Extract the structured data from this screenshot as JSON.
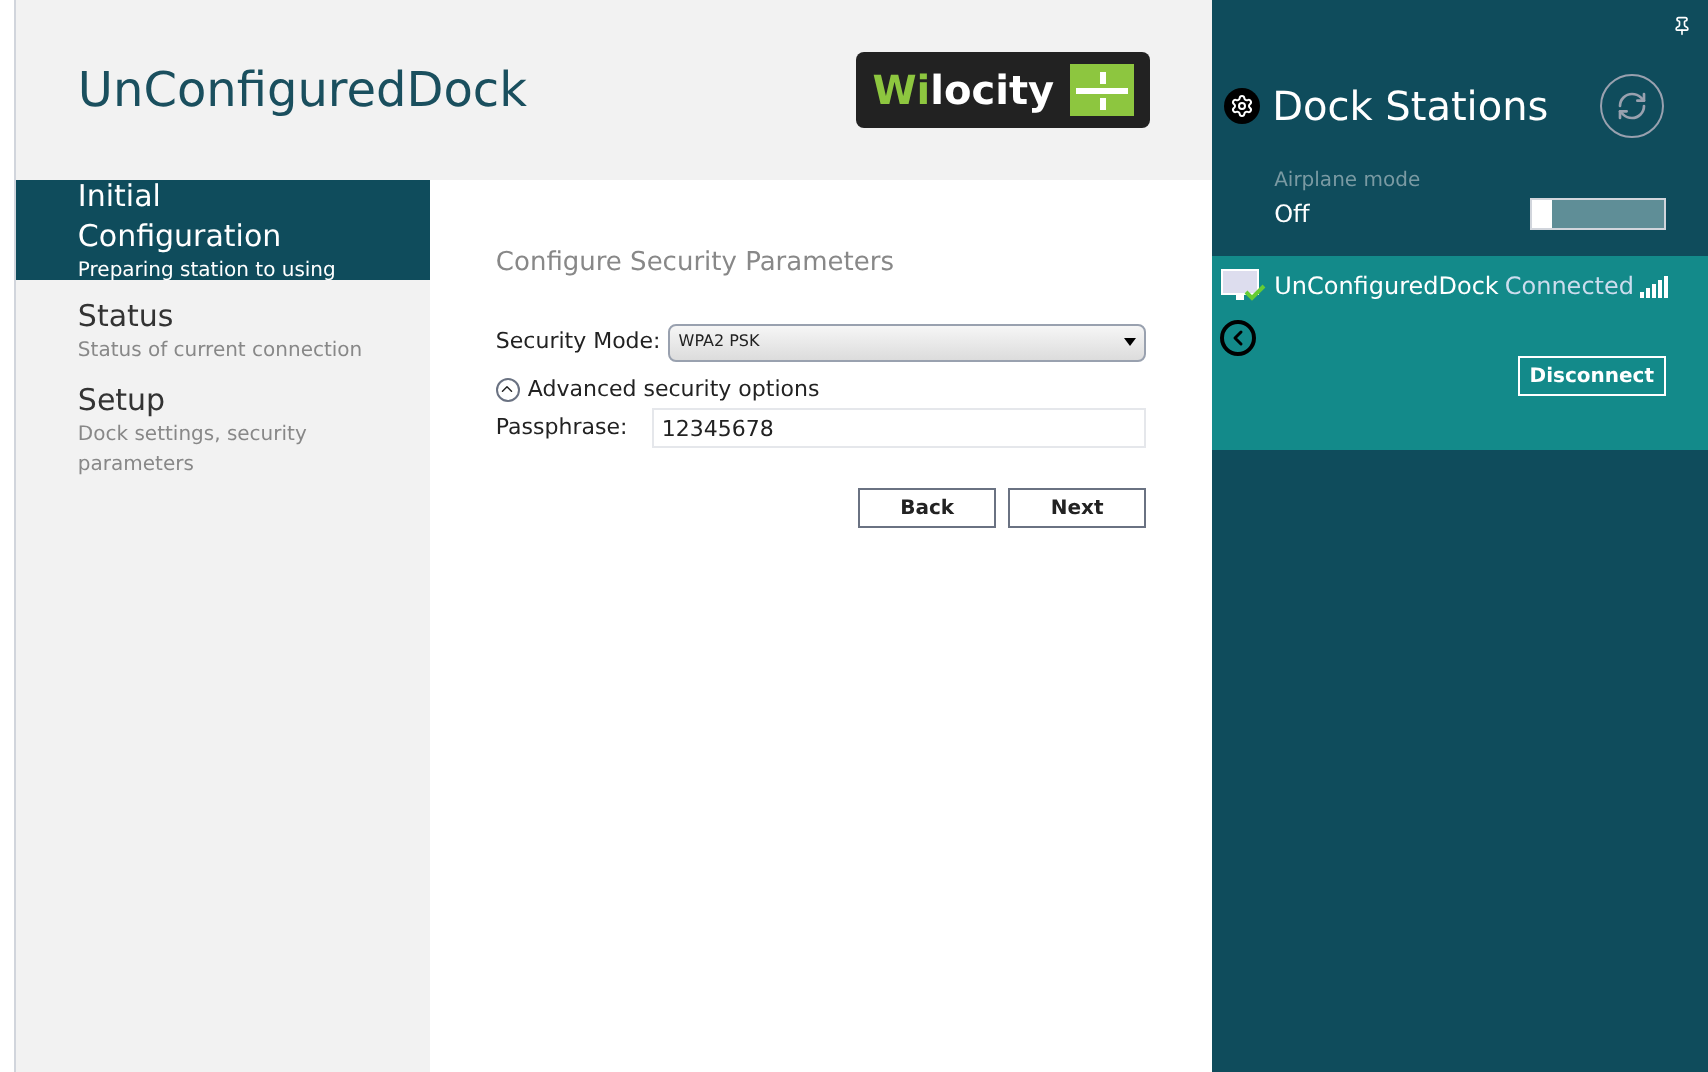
{
  "app": {
    "title": "UnConfiguredDock",
    "logo": {
      "accent": "Wi",
      "text": "locity"
    }
  },
  "sidebar": {
    "items": [
      {
        "label": "Initial Configuration",
        "sublabel": "Preparing station to using",
        "selected": true
      },
      {
        "label": "Status",
        "sublabel": "Status of current connection",
        "selected": false
      },
      {
        "label": "Setup",
        "sublabel": "Dock settings, security parameters",
        "selected": false
      }
    ]
  },
  "form": {
    "heading": "Configure Security Parameters",
    "security_mode": {
      "label": "Security Mode:",
      "value": "WPA2 PSK"
    },
    "advanced": {
      "label": "Advanced security options",
      "expanded": true
    },
    "passphrase": {
      "label": "Passphrase:",
      "value": "12345678"
    },
    "buttons": [
      "Back",
      "Next"
    ]
  },
  "charm": {
    "title": "Dock Stations",
    "airplane_mode": {
      "label": "Airplane mode",
      "state": "Off",
      "on": false
    },
    "networks": [
      {
        "name": "UnConfiguredDock",
        "status": "Connected",
        "selected": true,
        "action": "Disconnect"
      }
    ]
  }
}
